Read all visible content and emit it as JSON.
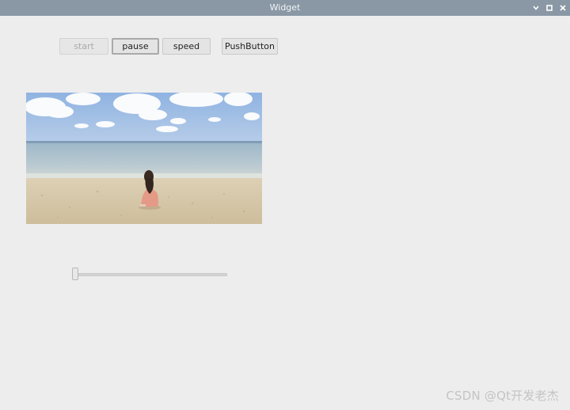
{
  "window": {
    "title": "Widget",
    "controls": {
      "minimize_icon": "chevron-down-icon",
      "maximize_icon": "maximize-icon",
      "close_icon": "close-icon"
    },
    "titlebar_color": "#8a98a5",
    "background_color": "#ededed"
  },
  "toolbar": {
    "start_label": "start",
    "start_enabled": false,
    "pause_label": "pause",
    "speed_label": "speed",
    "pushbutton_label": "PushButton"
  },
  "video": {
    "content": "beach-scene-image"
  },
  "progress_slider": {
    "value_fraction": 0.0
  },
  "watermark": {
    "text": "CSDN @Qt开发老杰"
  }
}
